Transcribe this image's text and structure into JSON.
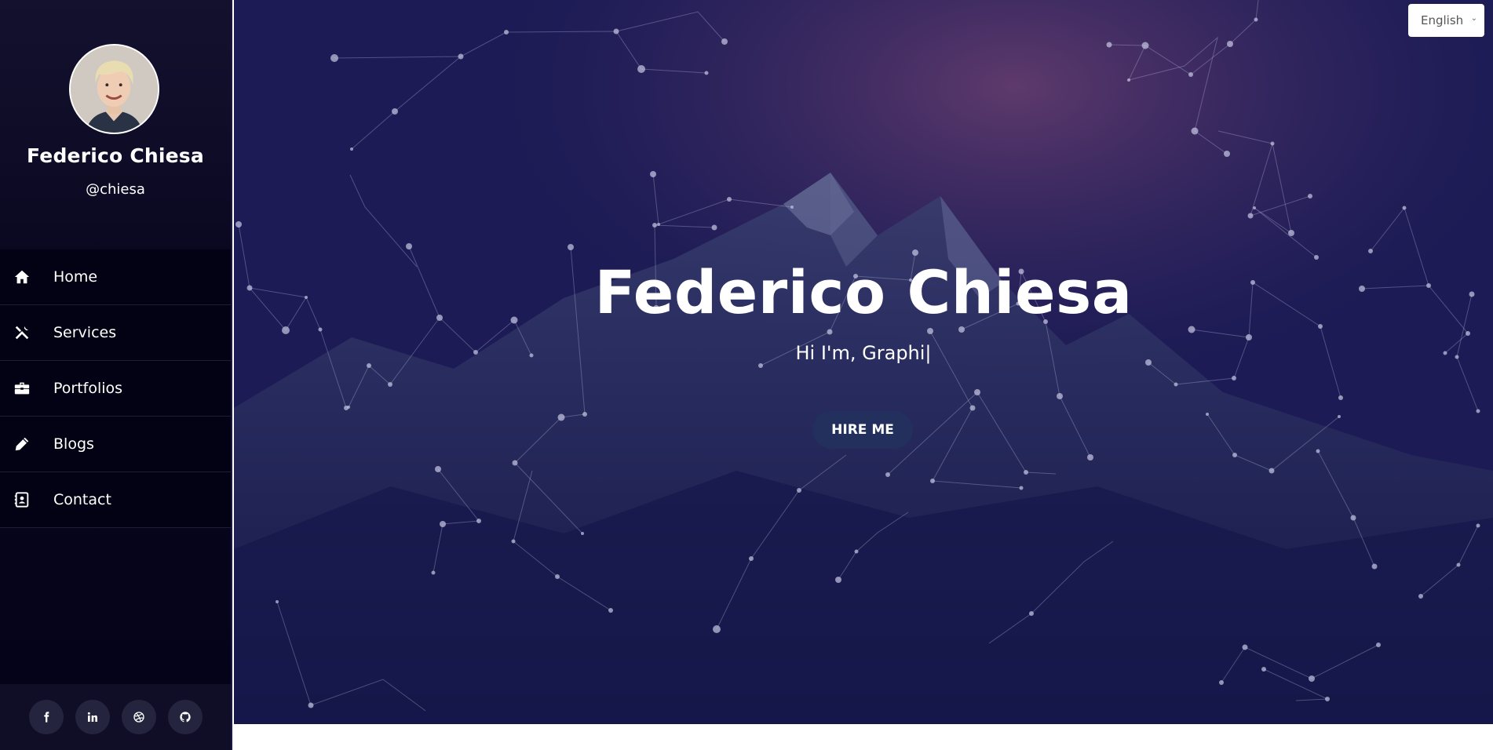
{
  "profile": {
    "name": "Federico Chiesa",
    "handle": "@chiesa"
  },
  "nav": {
    "items": [
      {
        "label": "Home",
        "icon": "home-icon"
      },
      {
        "label": "Services",
        "icon": "tools-icon"
      },
      {
        "label": "Portfolios",
        "icon": "briefcase-icon"
      },
      {
        "label": "Blogs",
        "icon": "pencil-icon"
      },
      {
        "label": "Contact",
        "icon": "address-book-icon"
      }
    ]
  },
  "social": {
    "items": [
      {
        "icon": "facebook-icon"
      },
      {
        "icon": "linkedin-icon"
      },
      {
        "icon": "dribbble-icon"
      },
      {
        "icon": "github-icon"
      }
    ]
  },
  "hero": {
    "title": "Federico Chiesa",
    "subtitle": "Hi I'm, Graphi|",
    "button_label": "HIRE ME"
  },
  "language": {
    "selected": "English"
  },
  "colors": {
    "sidebar_bg": "#0a0820",
    "hero_overlay": "#1a1950",
    "button_bg": "#23305e",
    "text": "#ffffff"
  }
}
